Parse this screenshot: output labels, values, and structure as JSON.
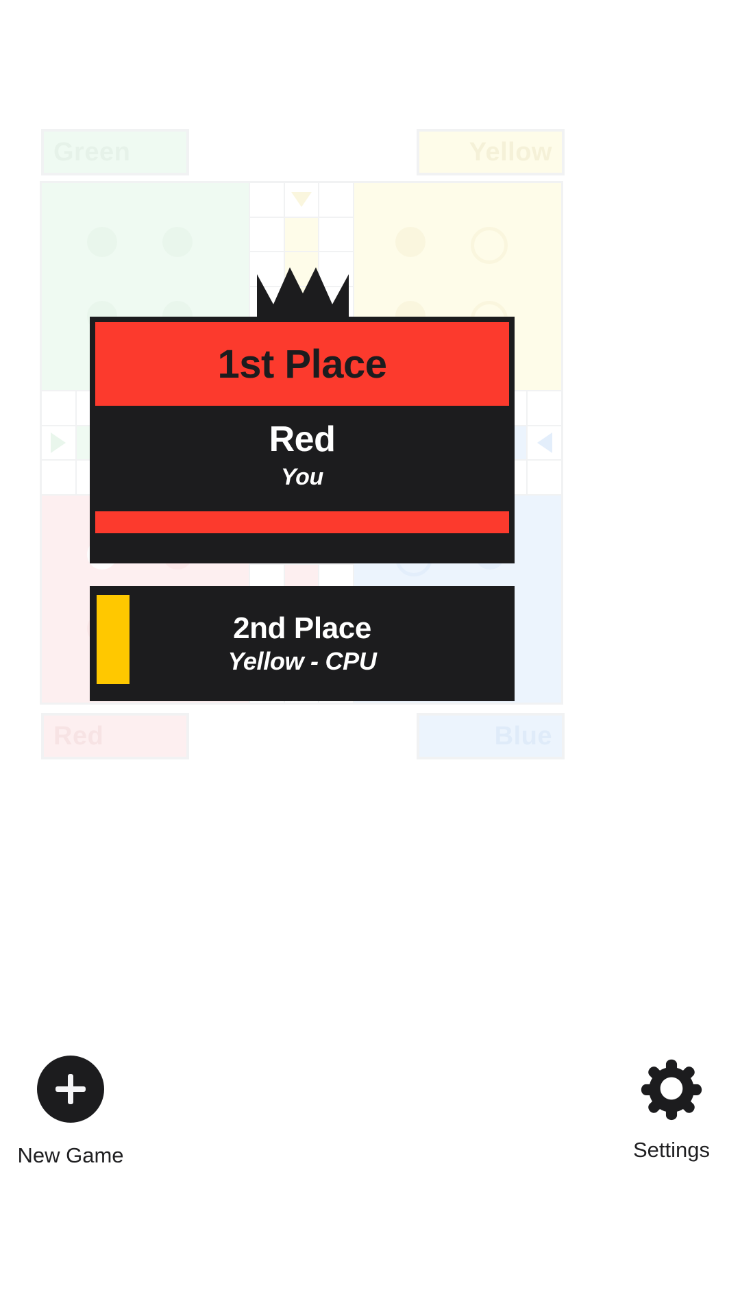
{
  "board": {
    "corner_labels": [
      {
        "name": "green",
        "text": "Green"
      },
      {
        "name": "yellow",
        "text": "Yellow"
      },
      {
        "name": "red",
        "text": "Red"
      },
      {
        "name": "blue",
        "text": "Blue"
      }
    ],
    "colors": {
      "green": "#effaf2",
      "yellow": "#fefce9",
      "red": "#fdeff0",
      "blue": "#ecf4fd",
      "grid_line": "#f1f2f3"
    }
  },
  "results": {
    "crown_icon": "crown-icon",
    "first": {
      "place_label": "1st Place",
      "player_name": "Red",
      "player_sub": "You",
      "color": "#fc3a2d",
      "banner_bg": "#fc3a2d",
      "card_bg": "#1c1c1e"
    },
    "second": {
      "place_label": "2nd Place",
      "player_sub": "Yellow - CPU",
      "color": "#ffc800",
      "card_bg": "#1c1c1e"
    }
  },
  "bottom": {
    "new_game": {
      "label": "New Game",
      "icon": "plus-icon"
    },
    "settings": {
      "label": "Settings",
      "icon": "gear-icon"
    }
  }
}
